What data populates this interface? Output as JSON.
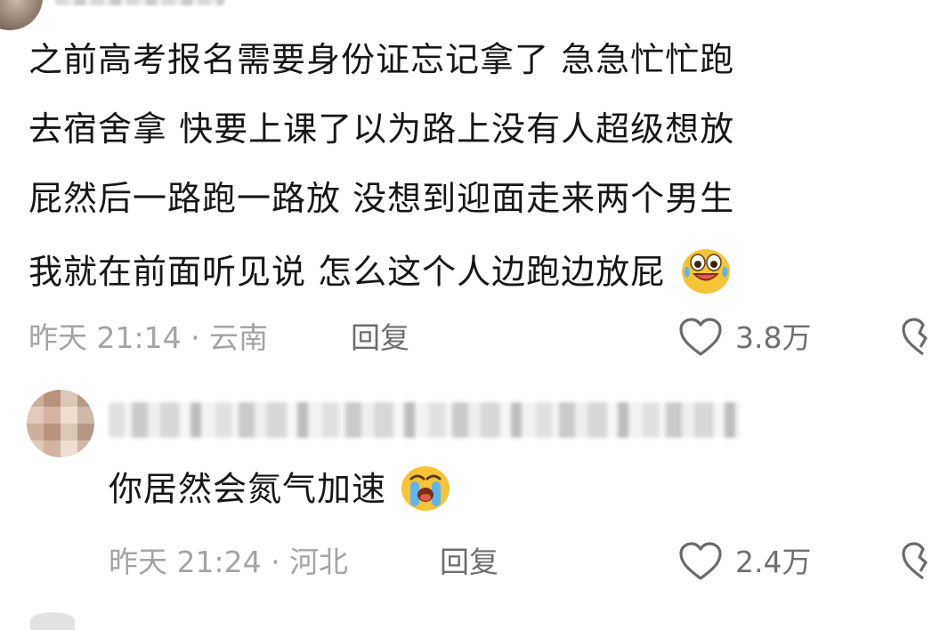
{
  "header": {
    "username": ""
  },
  "comment": {
    "lines": [
      "之前高考报名需要身份证忘记拿了 急急忙忙跑",
      "去宿舍拿 快要上课了以为路上没有人超级想放",
      "屁然后一路跑一路放 没想到迎面走来两个男生",
      "我就在前面听见说 怎么这个人边跑边放屁"
    ],
    "emoji": "laughing-crying-face",
    "meta": "昨天 21:14 · 云南",
    "reply_label": "回复",
    "like_count": "3.8万"
  },
  "reply": {
    "username": "",
    "text": "你居然会氮气加速",
    "emoji": "crying-face",
    "meta": "昨天 21:24 · 河北",
    "reply_label": "回复",
    "like_count": "2.4万"
  },
  "colors": {
    "text": "#161616",
    "meta": "#a4a4a4",
    "action": "#6e6e6e",
    "emoji_yellow": "#f6c436"
  }
}
